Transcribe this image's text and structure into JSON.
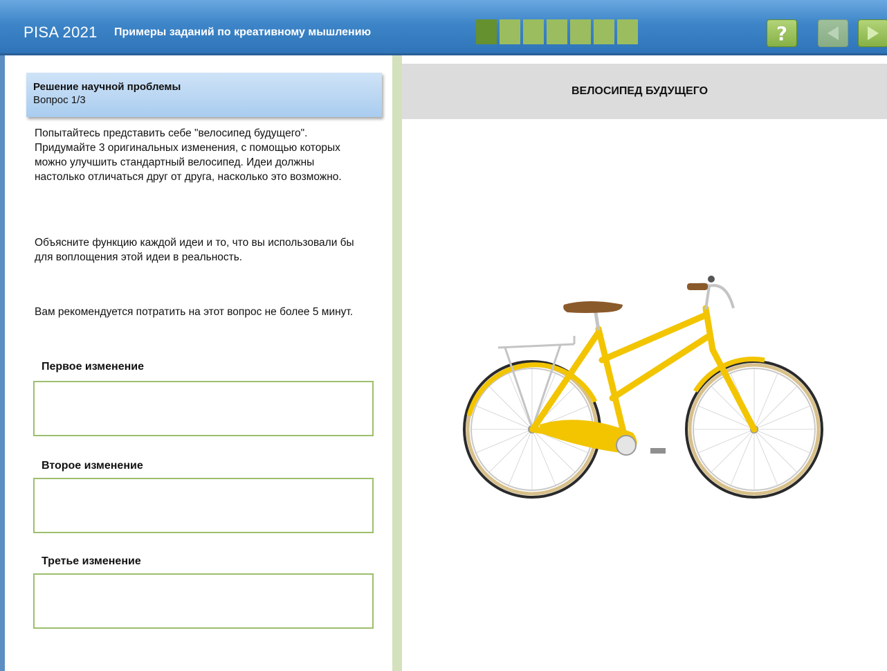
{
  "header": {
    "brand": "PISA 2021",
    "subtitle": "Примеры заданий по креативному мышлению",
    "progress": {
      "total_segments": 7,
      "current_segment": 1
    },
    "buttons": {
      "help_symbol": "?",
      "help_icon": "question-icon",
      "prev_icon": "triangle-left-icon",
      "next_icon": "triangle-right-icon"
    }
  },
  "question": {
    "title": "Решение научной проблемы",
    "number": "Вопрос 1/3",
    "paragraphs": [
      "Попытайтесь представить себе \"велосипед будущего\". Придумайте 3 оригинальных изменения, с помощью которых можно улучшить стандартный велосипед. Идеи должны настолько отличаться друг от друга, насколько это возможно.",
      "Объясните функцию каждой идеи и то, что вы использовали бы для воплощения этой идеи в реальность.",
      "Вам рекомендуется потратить на этот вопрос не более 5 минут."
    ],
    "answers": [
      {
        "label": "Первое изменение",
        "value": ""
      },
      {
        "label": "Второе изменение",
        "value": ""
      },
      {
        "label": "Третье изменение",
        "value": ""
      }
    ]
  },
  "stimulus": {
    "title": "ВЕЛОСИПЕД БУДУЩЕГО",
    "image": "yellow-bicycle-illustration"
  },
  "colors": {
    "header_blue": "#3d85c8",
    "accent_green": "#86b146",
    "progress_active": "#66912f",
    "progress_inactive": "#9bbd60",
    "bike_yellow": "#f2c500"
  }
}
